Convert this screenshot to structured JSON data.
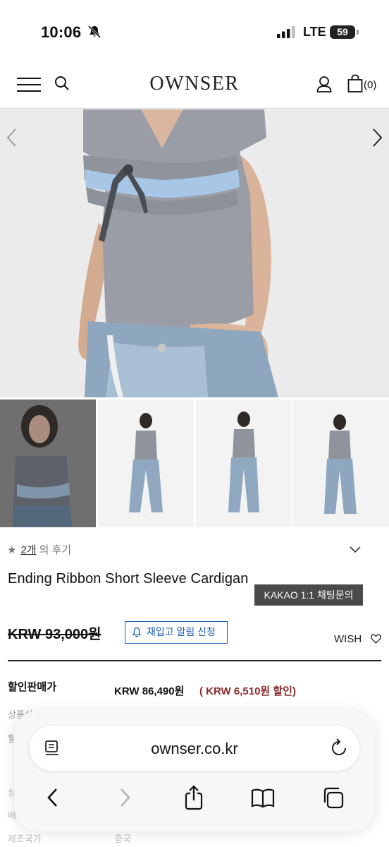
{
  "status": {
    "time": "10:06",
    "network": "LTE",
    "battery": "59"
  },
  "header": {
    "logo": "OWNSER",
    "cart_count": "(0)"
  },
  "review": {
    "star": "★",
    "count": "2개",
    "suffix": "의 후기"
  },
  "product": {
    "title": "Ending Ribbon Short Sleeve Cardigan",
    "kakao_button": "KAKAO 1:1 채팅문의",
    "original_price": "KRW 93,000원",
    "restock_button": "재입고 알림 신청",
    "wish_label": "WISH",
    "sale_label": "할인판매가",
    "sale_price": "KRW 86,490원",
    "discount": "( KRW 6,510원 할인)",
    "info_rows": [
      "상품설명",
      "할",
      "상",
      "배송",
      "제조국가"
    ],
    "origin_value": "중국"
  },
  "safari": {
    "url": "ownser.co.kr"
  },
  "colors": {
    "accent_blue": "#1b5fb0",
    "discount_red": "#8b2c2c",
    "kakao_bg": "#4a4a4a"
  }
}
